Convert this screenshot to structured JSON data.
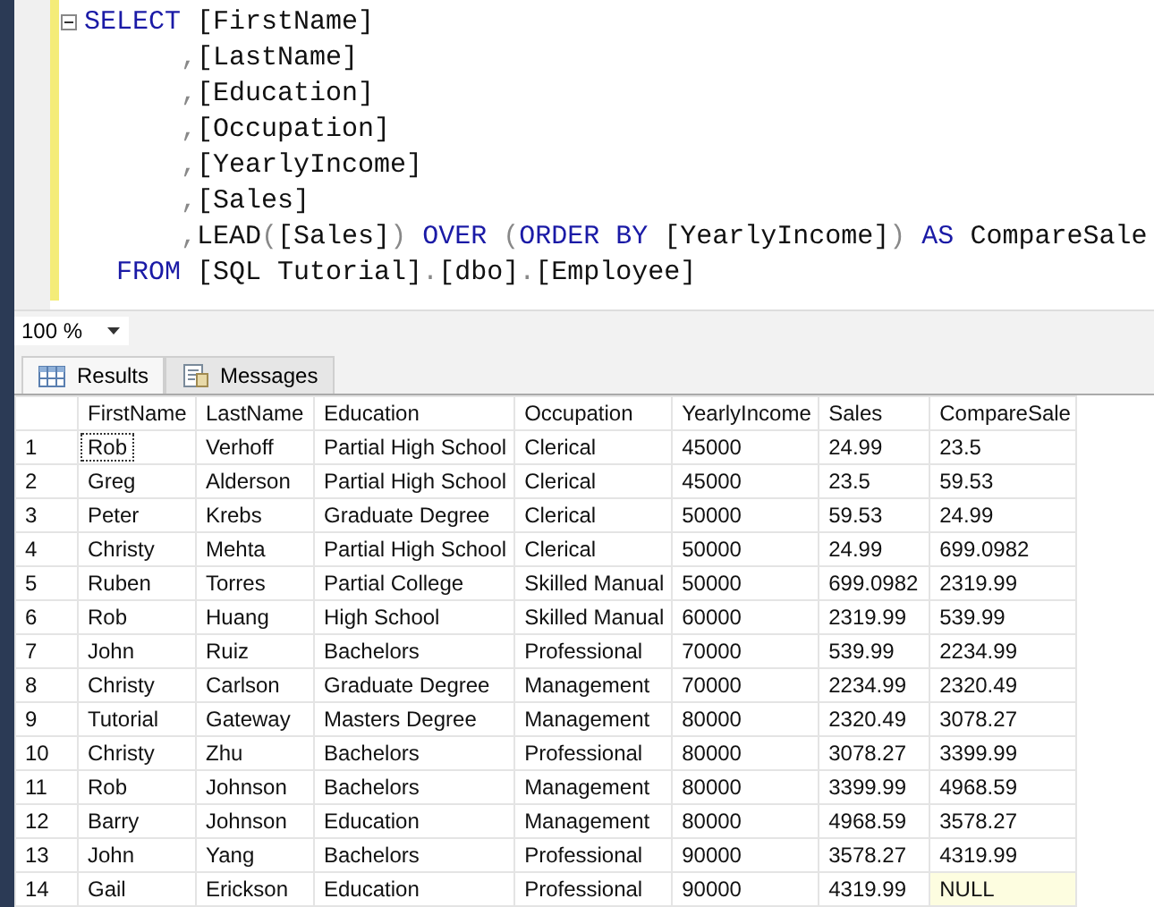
{
  "editor": {
    "lines": [
      {
        "collapsible": true,
        "kind": "select",
        "tokens": [
          {
            "kind": "keyword",
            "text": "SELECT"
          },
          {
            "kind": "plain",
            "text": " [FirstName]"
          }
        ]
      },
      {
        "collapsible": false,
        "kind": "continuation",
        "tokens": [
          {
            "kind": "punct",
            "text": ","
          },
          {
            "kind": "plain",
            "text": "[LastName]"
          }
        ]
      },
      {
        "collapsible": false,
        "kind": "continuation",
        "tokens": [
          {
            "kind": "punct",
            "text": ","
          },
          {
            "kind": "plain",
            "text": "[Education]"
          }
        ]
      },
      {
        "collapsible": false,
        "kind": "continuation",
        "tokens": [
          {
            "kind": "punct",
            "text": ","
          },
          {
            "kind": "plain",
            "text": "[Occupation]"
          }
        ]
      },
      {
        "collapsible": false,
        "kind": "continuation",
        "tokens": [
          {
            "kind": "punct",
            "text": ","
          },
          {
            "kind": "plain",
            "text": "[YearlyIncome]"
          }
        ]
      },
      {
        "collapsible": false,
        "kind": "continuation",
        "tokens": [
          {
            "kind": "punct",
            "text": ","
          },
          {
            "kind": "plain",
            "text": "[Sales]"
          }
        ]
      },
      {
        "collapsible": false,
        "kind": "continuation",
        "tokens": [
          {
            "kind": "punct",
            "text": ","
          },
          {
            "kind": "plain",
            "text": "LEAD"
          },
          {
            "kind": "punct",
            "text": "("
          },
          {
            "kind": "plain",
            "text": "[Sales]"
          },
          {
            "kind": "punct",
            "text": ")"
          },
          {
            "kind": "keyword",
            "text": " OVER"
          },
          {
            "kind": "punct",
            "text": " ("
          },
          {
            "kind": "keyword",
            "text": "ORDER BY"
          },
          {
            "kind": "plain",
            "text": " [YearlyIncome]"
          },
          {
            "kind": "punct",
            "text": ")"
          },
          {
            "kind": "keyword",
            "text": " AS"
          },
          {
            "kind": "plain",
            "text": " CompareSale"
          }
        ]
      },
      {
        "collapsible": false,
        "kind": "from",
        "tokens": [
          {
            "kind": "keyword",
            "text": "FROM"
          },
          {
            "kind": "plain",
            "text": " [SQL Tutorial]"
          },
          {
            "kind": "punct",
            "text": "."
          },
          {
            "kind": "plain",
            "text": "[dbo]"
          },
          {
            "kind": "punct",
            "text": "."
          },
          {
            "kind": "plain",
            "text": "[Employee]"
          }
        ]
      }
    ]
  },
  "zoom": {
    "value": "100 %"
  },
  "tabs": [
    {
      "label": "Results",
      "selected": true
    },
    {
      "label": "Messages",
      "selected": false
    }
  ],
  "grid": {
    "columns": [
      "FirstName",
      "LastName",
      "Education",
      "Occupation",
      "YearlyIncome",
      "Sales",
      "CompareSale"
    ],
    "rows": [
      {
        "number": "1",
        "focused": true,
        "last_is_null": false,
        "cells": [
          "Rob",
          "Verhoff",
          "Partial High School",
          "Clerical",
          "45000",
          "24.99",
          "23.5"
        ]
      },
      {
        "number": "2",
        "focused": false,
        "last_is_null": false,
        "cells": [
          "Greg",
          "Alderson",
          "Partial High School",
          "Clerical",
          "45000",
          "23.5",
          "59.53"
        ]
      },
      {
        "number": "3",
        "focused": false,
        "last_is_null": false,
        "cells": [
          "Peter",
          "Krebs",
          "Graduate Degree",
          "Clerical",
          "50000",
          "59.53",
          "24.99"
        ]
      },
      {
        "number": "4",
        "focused": false,
        "last_is_null": false,
        "cells": [
          "Christy",
          "Mehta",
          "Partial High School",
          "Clerical",
          "50000",
          "24.99",
          "699.0982"
        ]
      },
      {
        "number": "5",
        "focused": false,
        "last_is_null": false,
        "cells": [
          "Ruben",
          "Torres",
          "Partial College",
          "Skilled Manual",
          "50000",
          "699.0982",
          "2319.99"
        ]
      },
      {
        "number": "6",
        "focused": false,
        "last_is_null": false,
        "cells": [
          "Rob",
          "Huang",
          "High School",
          "Skilled Manual",
          "60000",
          "2319.99",
          "539.99"
        ]
      },
      {
        "number": "7",
        "focused": false,
        "last_is_null": false,
        "cells": [
          "John",
          "Ruiz",
          "Bachelors",
          "Professional",
          "70000",
          "539.99",
          "2234.99"
        ]
      },
      {
        "number": "8",
        "focused": false,
        "last_is_null": false,
        "cells": [
          "Christy",
          "Carlson",
          "Graduate Degree",
          "Management",
          "70000",
          "2234.99",
          "2320.49"
        ]
      },
      {
        "number": "9",
        "focused": false,
        "last_is_null": false,
        "cells": [
          "Tutorial",
          "Gateway",
          "Masters Degree",
          "Management",
          "80000",
          "2320.49",
          "3078.27"
        ]
      },
      {
        "number": "10",
        "focused": false,
        "last_is_null": false,
        "cells": [
          "Christy",
          "Zhu",
          "Bachelors",
          "Professional",
          "80000",
          "3078.27",
          "3399.99"
        ]
      },
      {
        "number": "11",
        "focused": false,
        "last_is_null": false,
        "cells": [
          "Rob",
          "Johnson",
          "Bachelors",
          "Management",
          "80000",
          "3399.99",
          "4968.59"
        ]
      },
      {
        "number": "12",
        "focused": false,
        "last_is_null": false,
        "cells": [
          "Barry",
          "Johnson",
          "Education",
          "Management",
          "80000",
          "4968.59",
          "3578.27"
        ]
      },
      {
        "number": "13",
        "focused": false,
        "last_is_null": false,
        "cells": [
          "John",
          "Yang",
          "Bachelors",
          "Professional",
          "90000",
          "3578.27",
          "4319.99"
        ]
      },
      {
        "number": "14",
        "focused": false,
        "last_is_null": true,
        "cells": [
          "Gail",
          "Erickson",
          "Education",
          "Professional",
          "90000",
          "4319.99",
          "NULL"
        ]
      }
    ]
  }
}
